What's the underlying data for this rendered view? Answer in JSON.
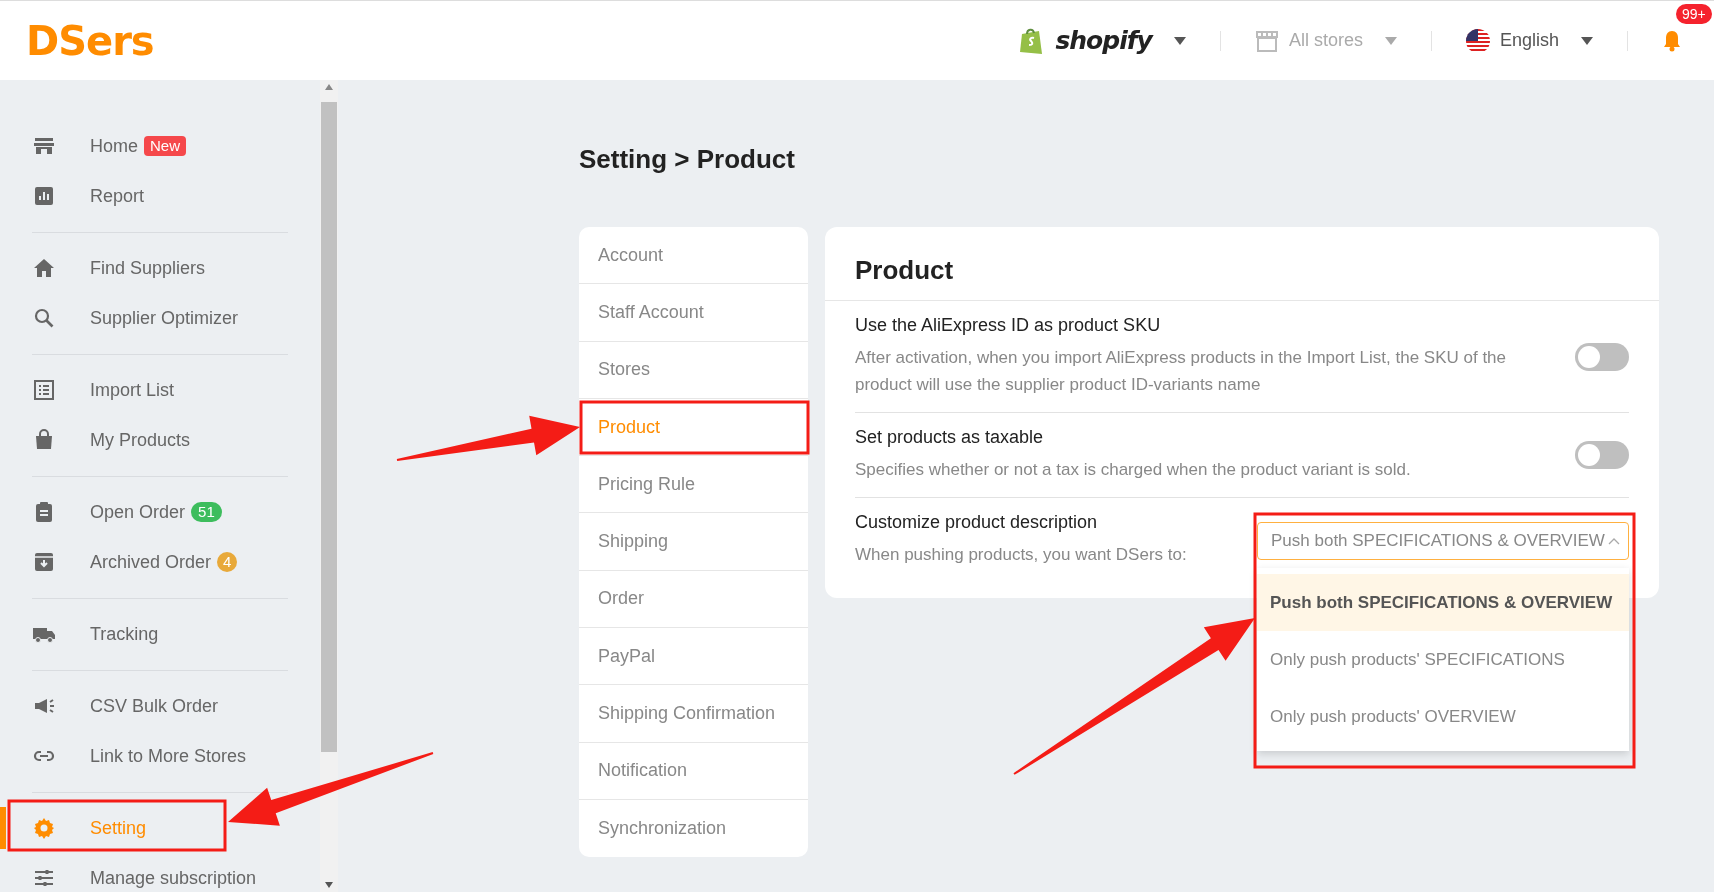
{
  "header": {
    "logo": "DSers",
    "platform": "shopify",
    "store": "All stores",
    "language": "English",
    "notification_count": "99+"
  },
  "sidebar": {
    "groups": [
      {
        "items": [
          {
            "label": "Home",
            "selected": false,
            "badge": {
              "text": "New",
              "color": "#f5484b",
              "kind": "tag"
            }
          },
          {
            "label": "Report",
            "selected": false
          }
        ]
      },
      {
        "items": [
          {
            "label": "Find Suppliers",
            "selected": false
          },
          {
            "label": "Supplier Optimizer",
            "selected": false
          }
        ]
      },
      {
        "items": [
          {
            "label": "Import List",
            "selected": false
          },
          {
            "label": "My Products",
            "selected": false
          }
        ]
      },
      {
        "items": [
          {
            "label": "Open Order",
            "selected": false,
            "badge": {
              "text": "51",
              "color": "#3dbd5d",
              "kind": "pill"
            }
          },
          {
            "label": "Archived Order",
            "selected": false,
            "badge": {
              "text": "4",
              "color": "#e8a93a",
              "kind": "dot"
            }
          }
        ]
      },
      {
        "items": [
          {
            "label": "Tracking",
            "selected": false
          }
        ]
      },
      {
        "items": [
          {
            "label": "CSV Bulk Order",
            "selected": false
          },
          {
            "label": "Link to More Stores",
            "selected": false
          }
        ]
      },
      {
        "items": [
          {
            "label": "Setting",
            "selected": true
          },
          {
            "label": "Manage subscription",
            "selected": false
          }
        ]
      }
    ]
  },
  "breadcrumb": "Setting > Product",
  "settings_menu": [
    {
      "label": "Account",
      "selected": false
    },
    {
      "label": "Staff Account",
      "selected": false
    },
    {
      "label": "Stores",
      "selected": false
    },
    {
      "label": "Product",
      "selected": true
    },
    {
      "label": "Pricing Rule",
      "selected": false
    },
    {
      "label": "Shipping",
      "selected": false
    },
    {
      "label": "Order",
      "selected": false
    },
    {
      "label": "PayPal",
      "selected": false
    },
    {
      "label": "Shipping Confirmation",
      "selected": false
    },
    {
      "label": "Notification",
      "selected": false
    },
    {
      "label": "Synchronization",
      "selected": false
    }
  ],
  "product_panel": {
    "title": "Product",
    "settings": [
      {
        "kind": "toggle",
        "title": "Use the AliExpress ID as product SKU",
        "description": "After activation, when you import AliExpress products in the Import List, the SKU of the product will use the supplier product ID-variants name",
        "on": false
      },
      {
        "kind": "toggle",
        "title": "Set products as taxable",
        "description": "Specifies whether or not a tax is charged when the product variant is sold.",
        "on": false
      },
      {
        "kind": "select",
        "title": "Customize product description",
        "description": "When pushing products, you want DSers to:",
        "value": "Push both SPECIFICATIONS & OVERVIEW",
        "expanded": true,
        "options": [
          {
            "label": "Push both SPECIFICATIONS & OVERVIEW",
            "selected": true
          },
          {
            "label": "Only push products' SPECIFICATIONS",
            "selected": false
          },
          {
            "label": "Only push products' OVERVIEW",
            "selected": false
          }
        ]
      }
    ]
  }
}
